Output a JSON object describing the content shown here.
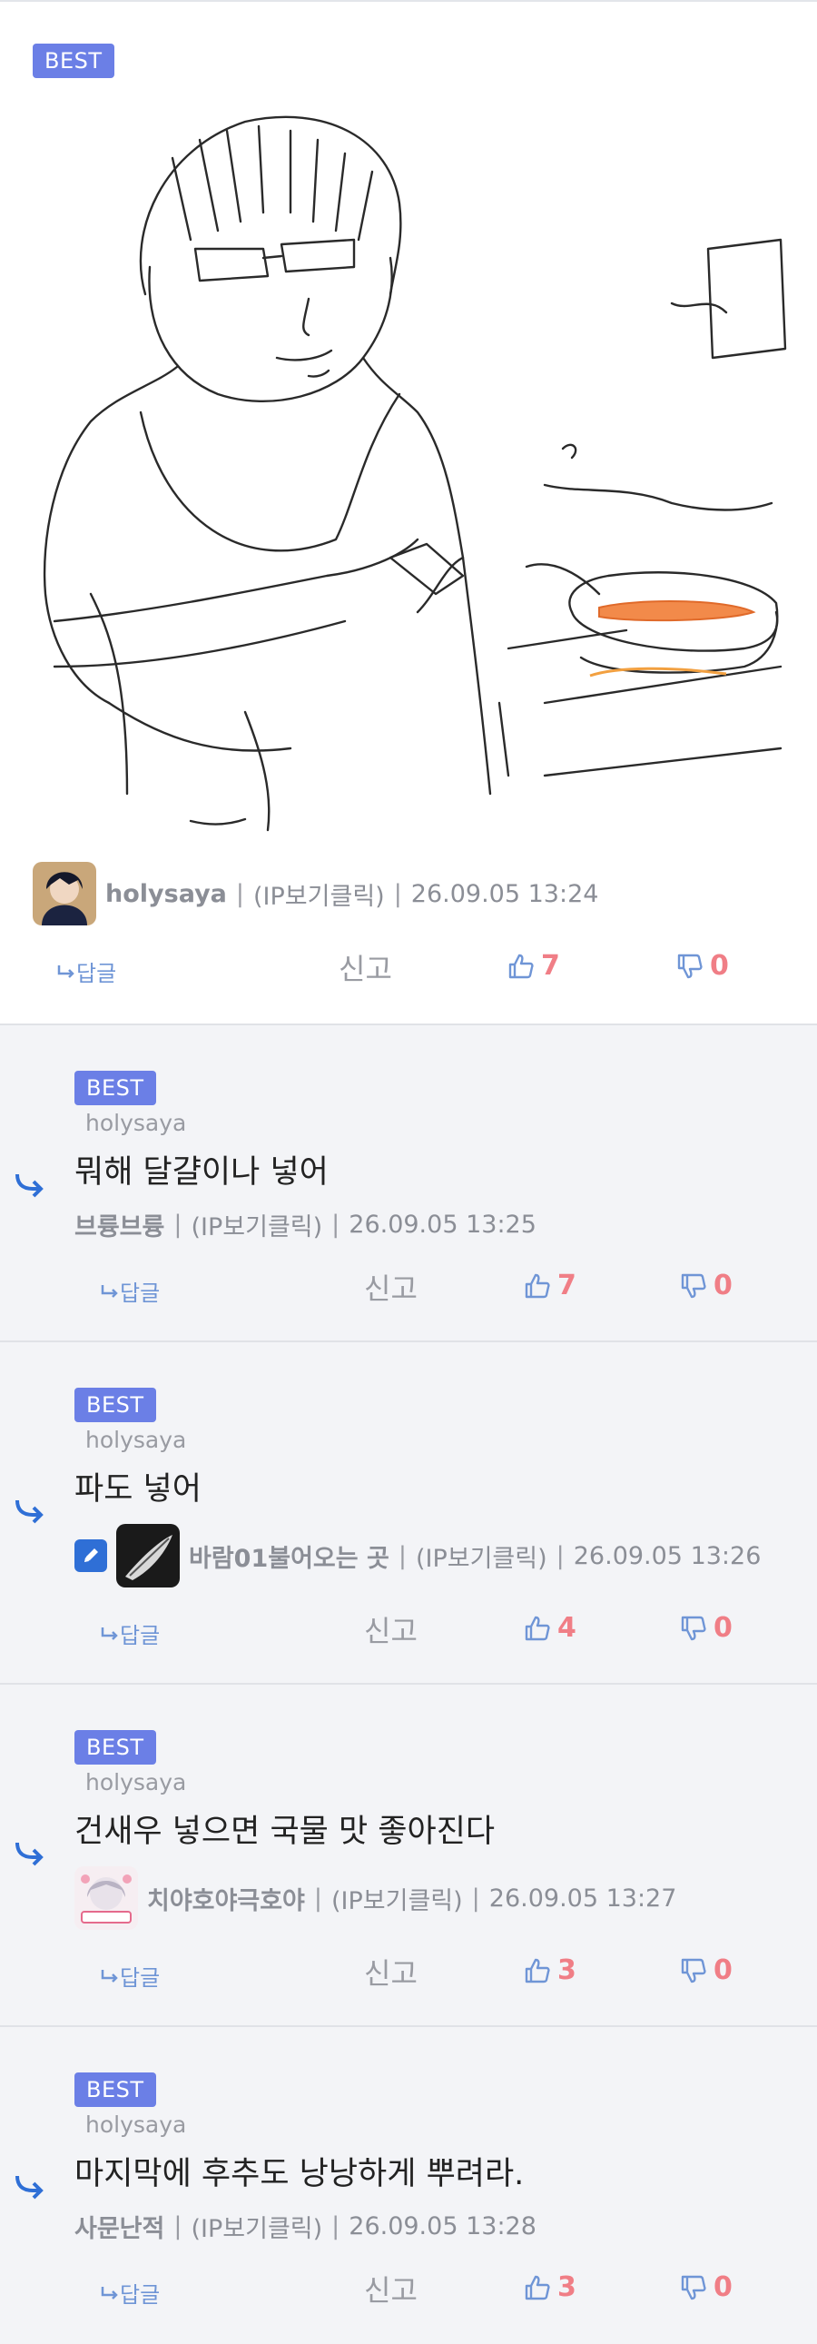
{
  "badge_label": "BEST",
  "post": {
    "author": "holysaya",
    "ip_label": "(IP보기클릭)",
    "datetime": "26.09.05 13:24",
    "reply_label": "답글",
    "report_label": "신고",
    "likes": "7",
    "dislikes": "0"
  },
  "comments": [
    {
      "to": "holysaya",
      "text": "뭐해 달걀이나 넣어",
      "author": "브륭브륭",
      "ip_label": "(IP보기클릭)",
      "datetime": "26.09.05 13:25",
      "reply_label": "답글",
      "report_label": "신고",
      "likes": "7",
      "dislikes": "0"
    },
    {
      "to": "holysaya",
      "text": "파도 넣어",
      "author": "바람01불어오는 곳",
      "ip_label": "(IP보기클릭)",
      "datetime": "26.09.05 13:26",
      "reply_label": "답글",
      "report_label": "신고",
      "likes": "4",
      "dislikes": "0"
    },
    {
      "to": "holysaya",
      "text": "건새우 넣으면 국물 맛 좋아진다",
      "author": "치야호야극호야",
      "ip_label": "(IP보기클릭)",
      "datetime": "26.09.05 13:27",
      "reply_label": "답글",
      "report_label": "신고",
      "likes": "3",
      "dislikes": "0"
    },
    {
      "to": "holysaya",
      "text": "마지막에 후추도 낭낭하게 뿌려라.",
      "author": "사문난적",
      "ip_label": "(IP보기클릭)",
      "datetime": "26.09.05 13:28",
      "reply_label": "답글",
      "report_label": "신고",
      "likes": "3",
      "dislikes": "0"
    }
  ],
  "colors": {
    "badge": "#6b7fe6",
    "count": "#f07e86",
    "reply": "#6f95d6",
    "reply_arrow": "#2f6fd6",
    "comment_bg": "#f3f4f7"
  }
}
